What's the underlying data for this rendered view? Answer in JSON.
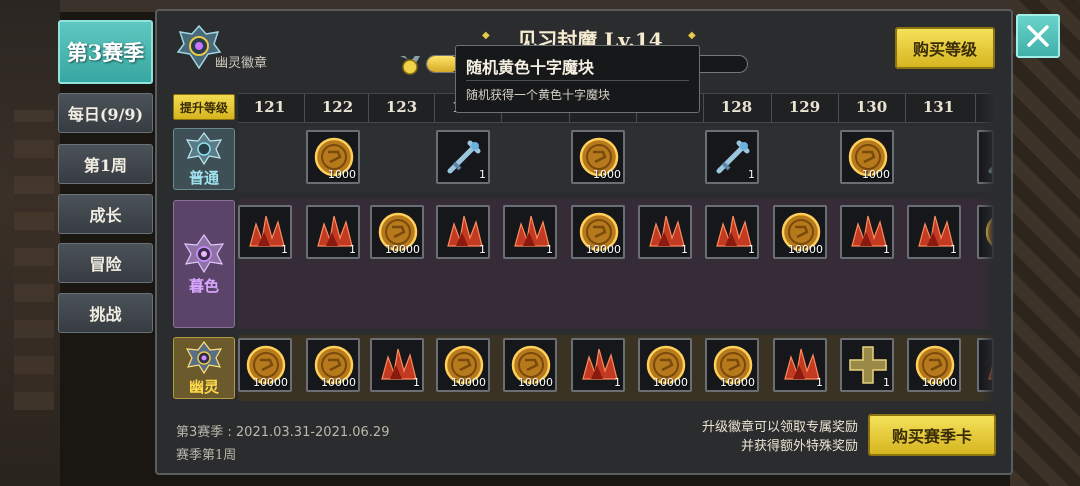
{
  "season_tab": "第3赛季",
  "side_menu": [
    {
      "label": "每日(9/9)"
    },
    {
      "label": "第1周"
    },
    {
      "label": "成长"
    },
    {
      "label": "冒险"
    },
    {
      "label": "挑战"
    }
  ],
  "badge": {
    "label": "幽灵徽章"
  },
  "level": {
    "title": "见习封魔 Lv.14",
    "progress": 0.1
  },
  "buttons": {
    "buy_level": "购买等级",
    "upgrade": "提升等级",
    "buy_season_card": "购买赛季卡"
  },
  "columns": [
    "121",
    "122",
    "123",
    "124",
    "125",
    "126",
    "127",
    "128",
    "129",
    "130",
    "131",
    ""
  ],
  "tiers": {
    "normal": "普通",
    "twilight": "暮色",
    "ghost": "幽灵"
  },
  "rows": {
    "normal": [
      null,
      {
        "type": "coin",
        "qty": "1000"
      },
      null,
      {
        "type": "cross-sword",
        "qty": "1"
      },
      null,
      {
        "type": "coin",
        "qty": "1000"
      },
      null,
      {
        "type": "cross-sword",
        "qty": "1"
      },
      null,
      {
        "type": "coin",
        "qty": "1000"
      },
      null,
      {
        "type": "cross-sword",
        "qty": ""
      }
    ],
    "twilight": [
      {
        "type": "red-crystal",
        "qty": "1"
      },
      {
        "type": "red-crystal",
        "qty": "1"
      },
      {
        "type": "coin",
        "qty": "10000"
      },
      {
        "type": "red-crystal",
        "qty": "1"
      },
      {
        "type": "red-crystal",
        "qty": "1"
      },
      {
        "type": "coin",
        "qty": "10000"
      },
      {
        "type": "red-crystal",
        "qty": "1"
      },
      {
        "type": "red-crystal",
        "qty": "1"
      },
      {
        "type": "coin",
        "qty": "10000"
      },
      {
        "type": "red-crystal",
        "qty": "1"
      },
      {
        "type": "red-crystal",
        "qty": "1"
      },
      {
        "type": "coin",
        "qty": ""
      }
    ],
    "ghost": [
      {
        "type": "coin",
        "qty": "10000"
      },
      {
        "type": "coin",
        "qty": "10000"
      },
      {
        "type": "red-crystal",
        "qty": "1"
      },
      {
        "type": "coin",
        "qty": "10000"
      },
      {
        "type": "coin",
        "qty": "10000"
      },
      {
        "type": "red-crystal",
        "qty": "1"
      },
      {
        "type": "coin",
        "qty": "10000"
      },
      {
        "type": "coin",
        "qty": "10000"
      },
      {
        "type": "red-crystal",
        "qty": "1"
      },
      {
        "type": "yellow-cross",
        "qty": "1"
      },
      {
        "type": "coin",
        "qty": "10000"
      },
      {
        "type": "red-crystal",
        "qty": ""
      }
    ]
  },
  "tooltip": {
    "title": "随机黄色十字魔块",
    "desc": "随机获得一个黄色十字魔块"
  },
  "footer": {
    "season_dates": "第3赛季 : 2021.03.31-2021.06.29",
    "season_week": "赛季第1周",
    "promo_line1": "升级徽章可以领取专属奖励",
    "promo_line2": "并获得额外特殊奖励"
  },
  "colors": {
    "accent_teal": "#4fbfb8",
    "accent_gold": "#e8c93a",
    "panel": "#2a2c2e"
  }
}
